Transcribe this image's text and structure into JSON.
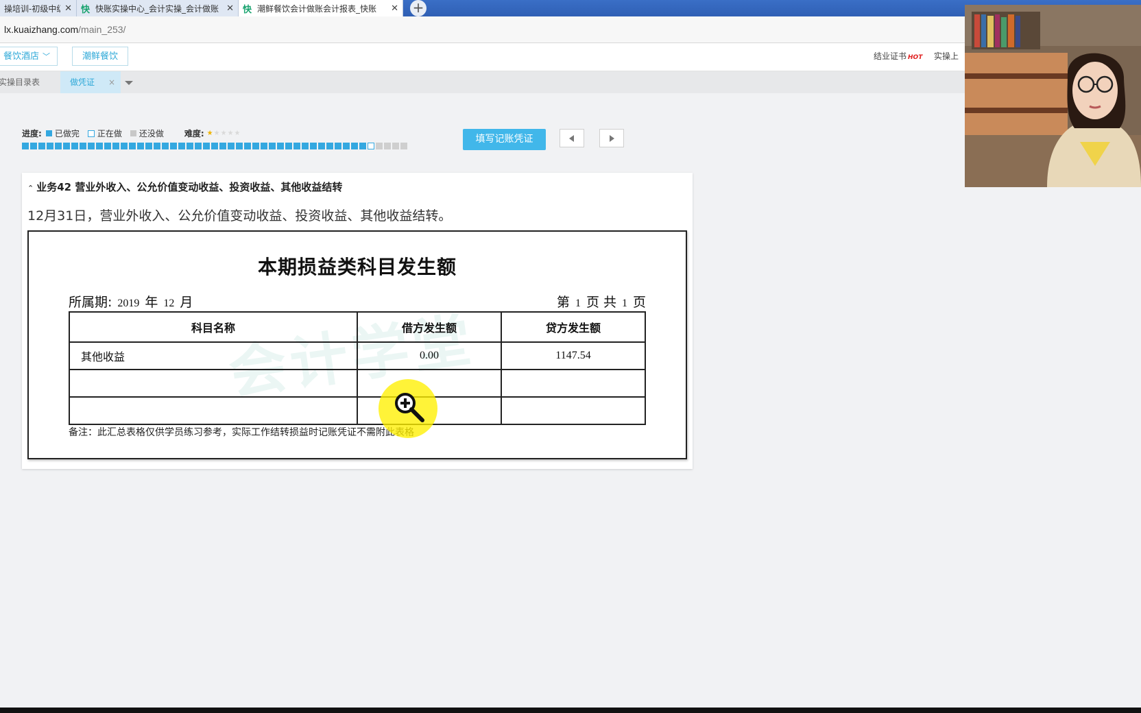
{
  "browser": {
    "tabs": [
      {
        "title": "操培训-初级中级",
        "icon": "",
        "active": false
      },
      {
        "title": "快账实操中心_会计实操_会计做账",
        "icon": "快",
        "active": false
      },
      {
        "title": "潮鲜餐饮会计做账会计报表_快账",
        "icon": "快",
        "active": true
      }
    ],
    "url_host": "lx.kuaizhang.com",
    "url_path": "/main_253/"
  },
  "header": {
    "industry_select": "餐饮酒店",
    "company": "潮鲜餐饮",
    "links": [
      "结业证书",
      "实操上"
    ],
    "hot_badge": "HOT"
  },
  "page_tabs": {
    "list_tab": "实操目录表",
    "active_tab": "做凭证",
    "close": "×"
  },
  "progress": {
    "label": "进度:",
    "done_label": "已做完",
    "doing_label": "正在做",
    "todo_label": "还没做",
    "difficulty_label": "难度:",
    "difficulty_level": 1,
    "difficulty_max": 5,
    "done_count": 42,
    "doing_count": 1,
    "todo_count": 4
  },
  "actions": {
    "fill_voucher": "填写记账凭证"
  },
  "business": {
    "heading": "业务42 营业外收入、公允价值变动收益、投资收益、其他收益结转",
    "description": "12月31日，营业外收入、公允价值变动收益、投资收益、其他收益结转。"
  },
  "document": {
    "title": "本期损益类科目发生额",
    "period_label": "所属期:",
    "year": "2019",
    "year_unit": "年",
    "month": "12",
    "month_unit": "月",
    "page_prefix": "第",
    "page_no": "1",
    "page_mid": "页 共",
    "page_total": "1",
    "page_suffix": "页",
    "watermark": "会计学堂",
    "columns": [
      "科目名称",
      "借方发生额",
      "贷方发生额"
    ],
    "rows": [
      {
        "account": "其他收益",
        "debit": "0.00",
        "credit": "1147.54"
      },
      {
        "account": "",
        "debit": "",
        "credit": ""
      },
      {
        "account": "",
        "debit": "",
        "credit": ""
      }
    ],
    "note": "备注：此汇总表格仅供学员练习参考，实际工作结转损益时记账凭证不需附此表格"
  },
  "colors": {
    "accent": "#41b7ea",
    "progress_done": "#34a8e0",
    "progress_todo": "#cfcfcf",
    "highlight": "#fff000"
  }
}
